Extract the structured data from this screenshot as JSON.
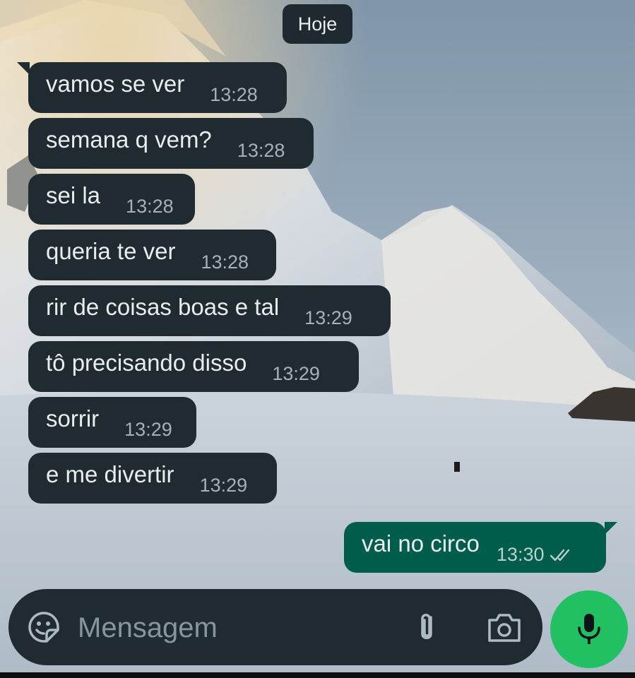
{
  "date_chip": "Hoje",
  "messages": [
    {
      "direction": "in",
      "text": "vamos se ver",
      "time": "13:28"
    },
    {
      "direction": "in",
      "text": "semana q vem?",
      "time": "13:28"
    },
    {
      "direction": "in",
      "text": "sei la",
      "time": "13:28"
    },
    {
      "direction": "in",
      "text": "queria te ver",
      "time": "13:28"
    },
    {
      "direction": "in",
      "text": "rir de coisas boas e tal",
      "time": "13:29"
    },
    {
      "direction": "in",
      "text": "tô precisando disso",
      "time": "13:29"
    },
    {
      "direction": "in",
      "text": "sorrir",
      "time": "13:29"
    },
    {
      "direction": "in",
      "text": "e me divertir",
      "time": "13:29"
    },
    {
      "direction": "out",
      "text": "vai no circo",
      "time": "13:30",
      "status": "read"
    }
  ],
  "composer": {
    "placeholder": "Mensagem",
    "icons": [
      "sticker-icon",
      "paperclip-icon",
      "camera-icon"
    ]
  },
  "mic_button": {
    "icon": "microphone-icon"
  },
  "colors": {
    "incoming_bubble": "#1f2b31",
    "outgoing_bubble": "#005c4b",
    "accent_green": "#21c063",
    "read_ticks": "#b5d3cb"
  }
}
